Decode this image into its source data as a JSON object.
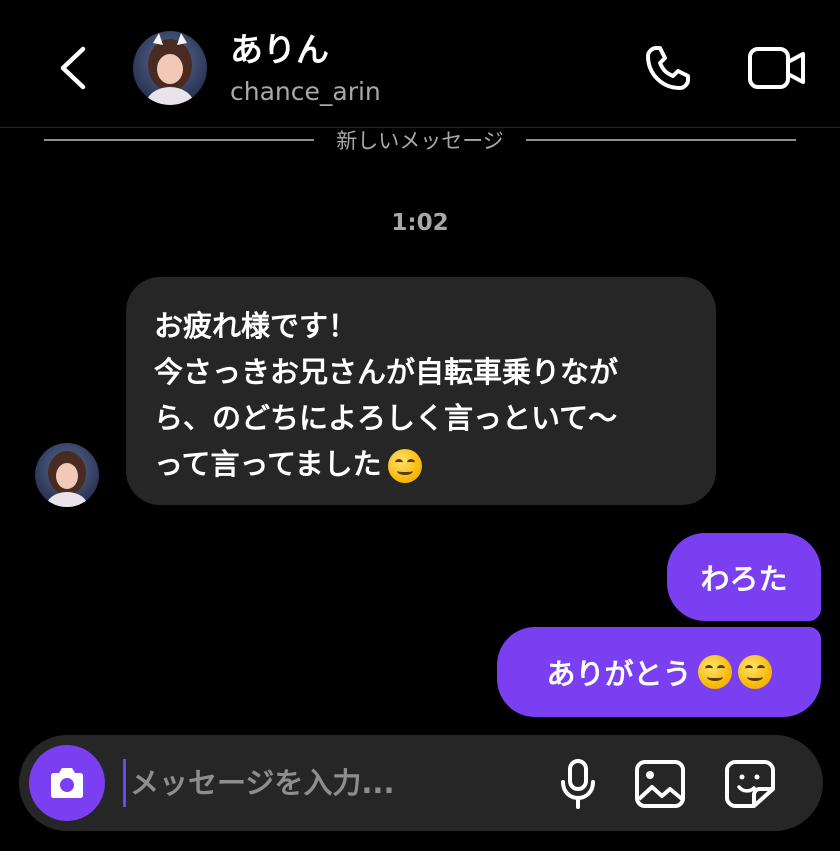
{
  "header": {
    "name": "ありん",
    "username": "chance_arin"
  },
  "divider": {
    "label": "新しいメッセージ"
  },
  "thread": {
    "timestamp": "1:02",
    "incoming": {
      "text": "お疲れ様です！\n今さっきお兄さんが自転車乗りなが\nら、のどちによろしく言っといて〜\nって言ってました"
    },
    "outgoing": [
      {
        "text": "わろた"
      },
      {
        "text": "ありがとう"
      }
    ]
  },
  "composer": {
    "placeholder": "メッセージを入力..."
  },
  "colors": {
    "accent": "#7a3ff0",
    "bubble_in": "#262626",
    "background": "#000000",
    "muted_text": "#a8a8a8"
  },
  "icons": [
    "chevron-left-icon",
    "phone-icon",
    "video-camera-icon",
    "camera-icon",
    "microphone-icon",
    "gallery-icon",
    "sticker-icon"
  ]
}
